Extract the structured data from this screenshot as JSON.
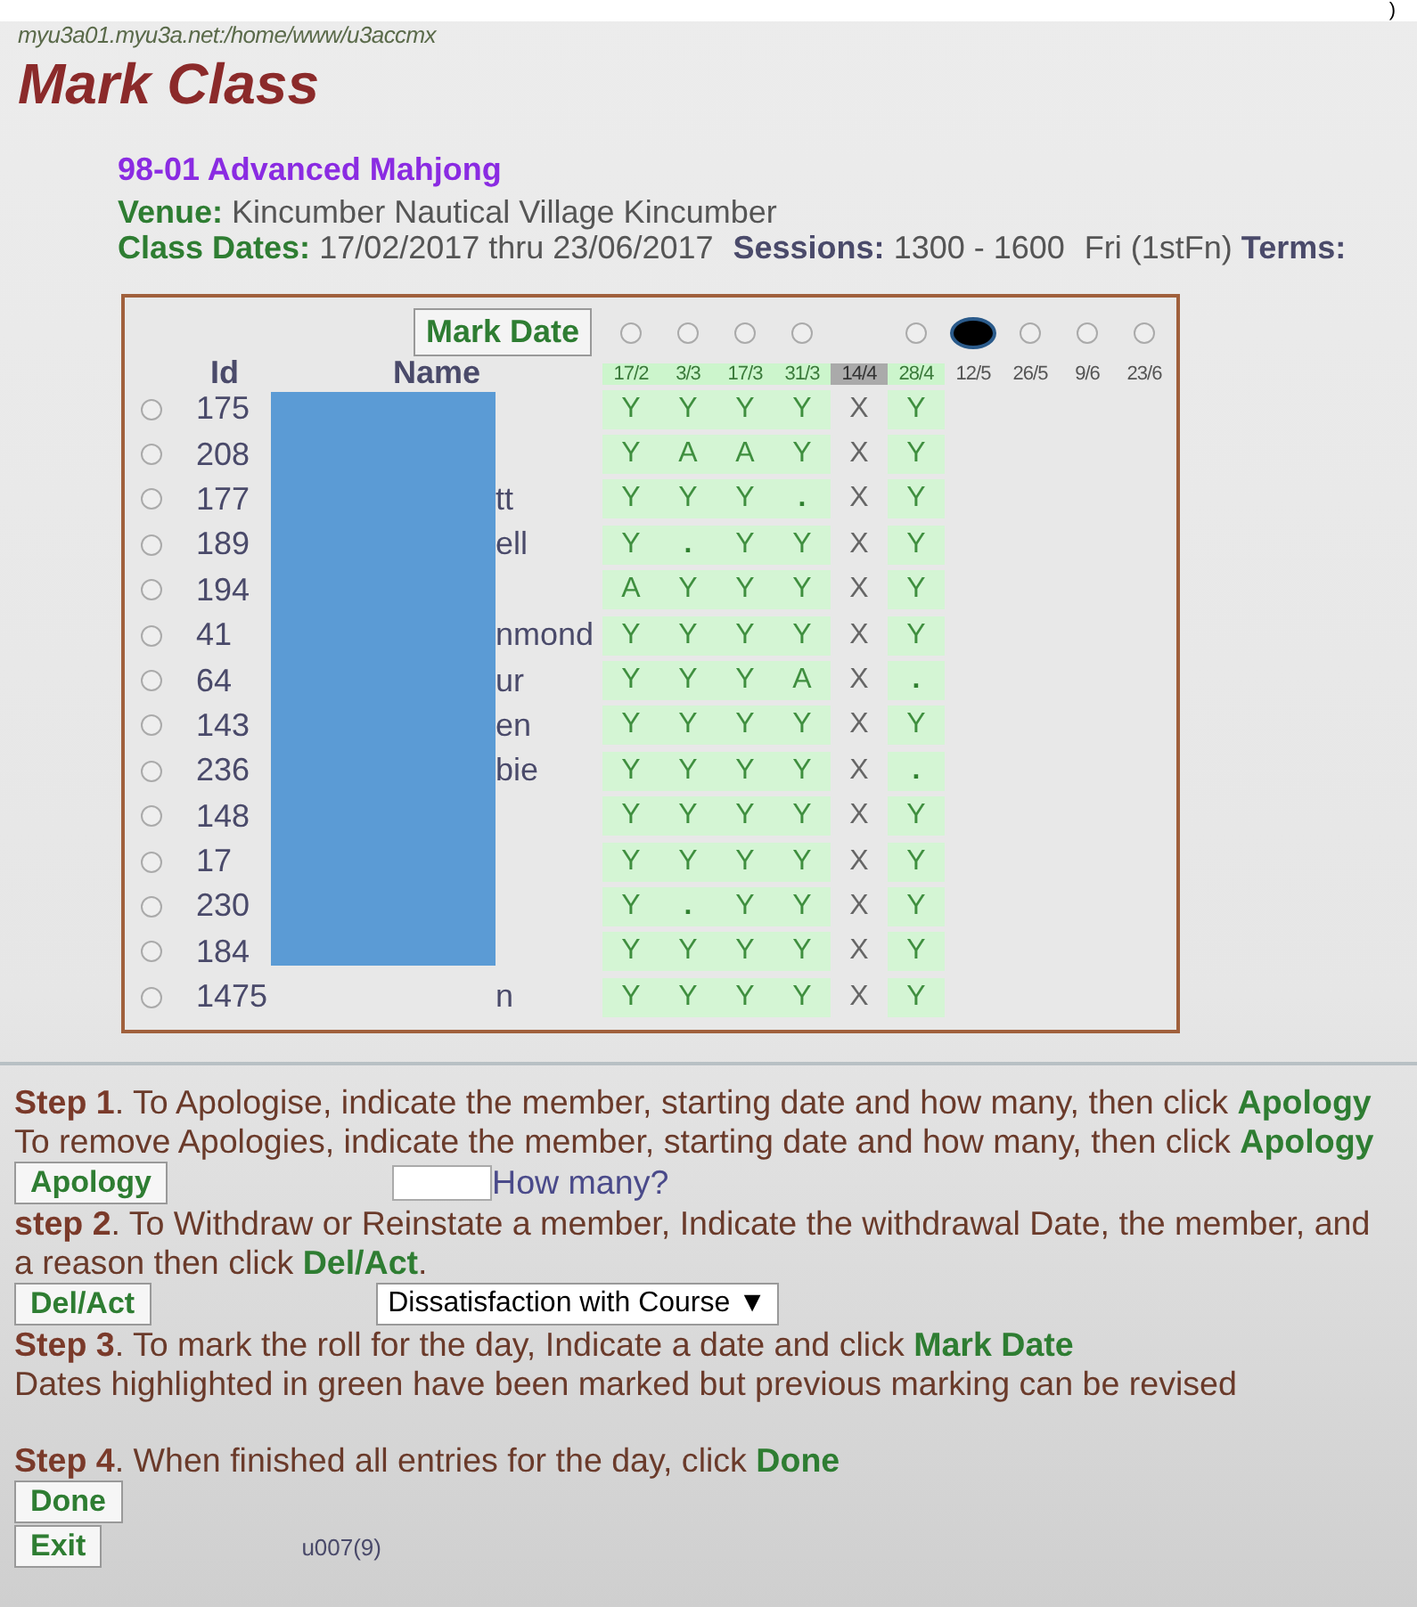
{
  "edge_fragment": ")",
  "path": "myu3a01.myu3a.net:/home/www/u3accmx",
  "title": "Mark Class",
  "course": "98-01 Advanced Mahjong",
  "venue": {
    "label": "Venue:",
    "value": "Kincumber Nautical Village Kincumber"
  },
  "class_dates": {
    "label": "Class Dates:",
    "value": "17/02/2017 thru 23/06/2017",
    "sessions_label": "Sessions:",
    "sessions": "1300 - 1600",
    "day": "Fri (1stFn)",
    "terms_label": "Terms:"
  },
  "mark_date_button": "Mark Date",
  "columns": {
    "id": "Id",
    "name": "Name"
  },
  "dates": [
    {
      "label": "17/2",
      "marked": true,
      "closed": false,
      "selected": false
    },
    {
      "label": "3/3",
      "marked": true,
      "closed": false,
      "selected": false
    },
    {
      "label": "17/3",
      "marked": true,
      "closed": false,
      "selected": false
    },
    {
      "label": "31/3",
      "marked": true,
      "closed": false,
      "selected": false
    },
    {
      "label": "14/4",
      "marked": false,
      "closed": true
    },
    {
      "label": "28/4",
      "marked": true,
      "closed": false,
      "selected": false
    },
    {
      "label": "12/5",
      "marked": false,
      "closed": false,
      "selected": true
    },
    {
      "label": "26/5",
      "marked": false,
      "closed": false,
      "selected": false
    },
    {
      "label": "9/6",
      "marked": false,
      "closed": false,
      "selected": false
    },
    {
      "label": "23/6",
      "marked": false,
      "closed": false,
      "selected": false
    }
  ],
  "members": [
    {
      "id": "175",
      "selected": false,
      "marks": [
        "Y",
        "Y",
        "Y",
        "Y",
        "X",
        "Y"
      ]
    },
    {
      "id": "208",
      "selected": false,
      "marks": [
        "Y",
        "A",
        "A",
        "Y",
        "X",
        "Y"
      ]
    },
    {
      "id": "177",
      "name": "tt",
      "selected": false,
      "marks": [
        "Y",
        "Y",
        "Y",
        ".",
        "X",
        "Y"
      ]
    },
    {
      "id": "189",
      "name": "ell",
      "selected": false,
      "marks": [
        "Y",
        ".",
        "Y",
        "Y",
        "X",
        "Y"
      ]
    },
    {
      "id": "194",
      "selected": false,
      "marks": [
        "A",
        "Y",
        "Y",
        "Y",
        "X",
        "Y"
      ]
    },
    {
      "id": "41",
      "name": "nmond",
      "selected": false,
      "marks": [
        "Y",
        "Y",
        "Y",
        "Y",
        "X",
        "Y"
      ]
    },
    {
      "id": "64",
      "name": "ur",
      "selected": false,
      "marks": [
        "Y",
        "Y",
        "Y",
        "A",
        "X",
        "."
      ]
    },
    {
      "id": "143",
      "name": "en",
      "selected": false,
      "marks": [
        "Y",
        "Y",
        "Y",
        "Y",
        "X",
        "Y"
      ]
    },
    {
      "id": "236",
      "name": "bie",
      "selected": false,
      "marks": [
        "Y",
        "Y",
        "Y",
        "Y",
        "X",
        "."
      ]
    },
    {
      "id": "148",
      "selected": false,
      "marks": [
        "Y",
        "Y",
        "Y",
        "Y",
        "X",
        "Y"
      ]
    },
    {
      "id": "17",
      "selected": false,
      "marks": [
        "Y",
        "Y",
        "Y",
        "Y",
        "X",
        "Y"
      ]
    },
    {
      "id": "230",
      "selected": false,
      "marks": [
        "Y",
        ".",
        "Y",
        "Y",
        "X",
        "Y"
      ]
    },
    {
      "id": "184",
      "selected": false,
      "marks": [
        "Y",
        "Y",
        "Y",
        "Y",
        "X",
        "Y"
      ]
    },
    {
      "id": "1475",
      "name": "n",
      "selected": false,
      "marks": [
        "Y",
        "Y",
        "Y",
        "Y",
        "X",
        "Y"
      ]
    }
  ],
  "steps": [
    {
      "lead": "Step 1",
      "text": ". To Apologise, indicate the member, starting date and how many, then click **Apology**"
    },
    {
      "text": "To remove Apologies, indicate the member, starting date and how many, then click **Apology**"
    },
    {
      "kind": "apology",
      "button": "Apology",
      "hint": "How many?"
    },
    {
      "lead": "step 2",
      "text": ". To Withdraw or Reinstate a member, Indicate the withdrawal Date, the member, and a reason then click **Del/Act**."
    },
    {
      "kind": "withdraw",
      "button": "Del/Act",
      "reason": "Dissatisfaction with Course ▼"
    },
    {
      "lead": "Step 3",
      "text": ". To mark the roll for the day, Indicate a date and click **Mark Date**"
    },
    {
      "text": "Dates highlighted in green have been marked but previous marking can be revised"
    },
    {
      "kind": "gap"
    },
    {
      "lead": "Step 4",
      "text": ". When finished all entries for the day, click **Done**"
    },
    {
      "kind": "button",
      "button": "Done"
    },
    {
      "kind": "exit",
      "button": "Exit",
      "code": "u007(9)"
    }
  ]
}
